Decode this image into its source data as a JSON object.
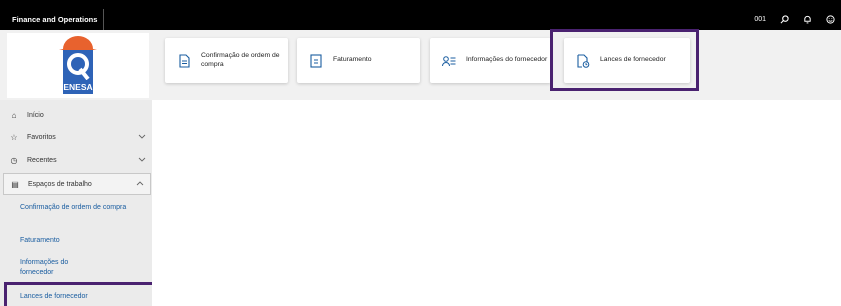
{
  "topbar": {
    "app_title": "Finance and Operations",
    "company": "001",
    "icons": [
      "search-icon",
      "bell-icon",
      "smiley-icon"
    ]
  },
  "logo": {
    "text": "ENESA",
    "colors": {
      "blue": "#2e63b7",
      "orange": "#e8622e"
    }
  },
  "tiles": [
    {
      "label": "Confirmação de ordem de compra",
      "icon": "document-icon"
    },
    {
      "label": "Faturamento",
      "icon": "invoice-icon"
    },
    {
      "label": "Informações do fornecedor",
      "icon": "person-list-icon"
    },
    {
      "label": "Lances de fornecedor",
      "icon": "document-clock-icon"
    }
  ],
  "sidebar": {
    "items": [
      {
        "label": "Início",
        "icon": "home-icon"
      },
      {
        "label": "Favoritos",
        "icon": "star-icon"
      },
      {
        "label": "Recentes",
        "icon": "clock-icon"
      },
      {
        "label": "Espaços de trabalho",
        "icon": "workspace-icon"
      }
    ],
    "workspaces": [
      "Confirmação de ordem de compra",
      "Faturamento",
      "Informações do fornecedor",
      "Lances de fornecedor"
    ]
  },
  "colors": {
    "highlight": "#4a2270",
    "link": "#1a5da0",
    "topbar": "#000000"
  }
}
